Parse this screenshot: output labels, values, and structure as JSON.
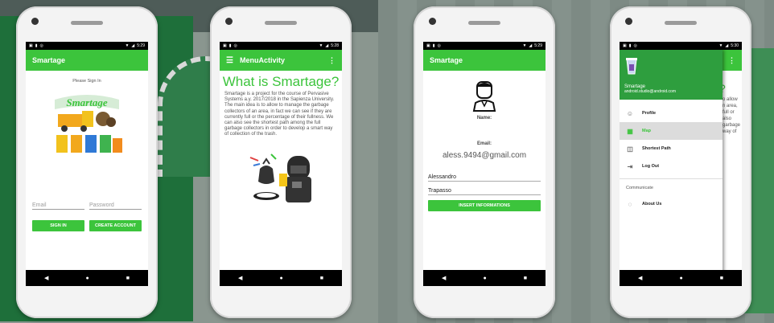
{
  "status": {
    "time1": "5:29",
    "time2": "5:28",
    "time3": "5:29",
    "time4": "5:30"
  },
  "login": {
    "app_title": "Smartage",
    "subtitle": "Please Sign In",
    "logo_text": "Smartage",
    "email_placeholder": "Email",
    "password_placeholder": "Password",
    "sign_in_label": "SIGN IN",
    "create_account_label": "CREATE ACCOUNT"
  },
  "menu_activity": {
    "app_title": "MenuActivity",
    "heading": "What is Smartage?",
    "body": "Smartage is a project for the course of Pervasive Systems a.y. 2017/2018 in the Sapienza University. The main idea is to allow to manage the garbage collectors of an area, in fact we can see if they are currently full or the percentage of their fullness. We can also see the shortest path among the full garbage collectors in order to develop a smart way of collection of the trash."
  },
  "profile": {
    "app_title": "Smartage",
    "name_label": "Name:",
    "email_label": "Email:",
    "email_value": "aless.9494@gmail.com",
    "first_name_value": "Alessandro",
    "last_name_value": "Trapasso",
    "insert_label": "INSERT INFORMATIONS"
  },
  "drawer": {
    "user_name": "Smartage",
    "user_email": "android.studio@android.com",
    "items": [
      {
        "label": "Profile",
        "icon": "person-icon"
      },
      {
        "label": "Map",
        "icon": "map-icon"
      },
      {
        "label": "Shortest Path",
        "icon": "path-icon"
      },
      {
        "label": "Log Out",
        "icon": "logout-icon"
      }
    ],
    "section_label": "Communicate",
    "about_label": "About Us",
    "behind_heading": "?",
    "behind_text": "o allow\nn area,\nfull or\nalso\ngarbage\nway of"
  },
  "colors": {
    "accent": "#3cc43c",
    "drawer_header": "#2e9e3e"
  }
}
